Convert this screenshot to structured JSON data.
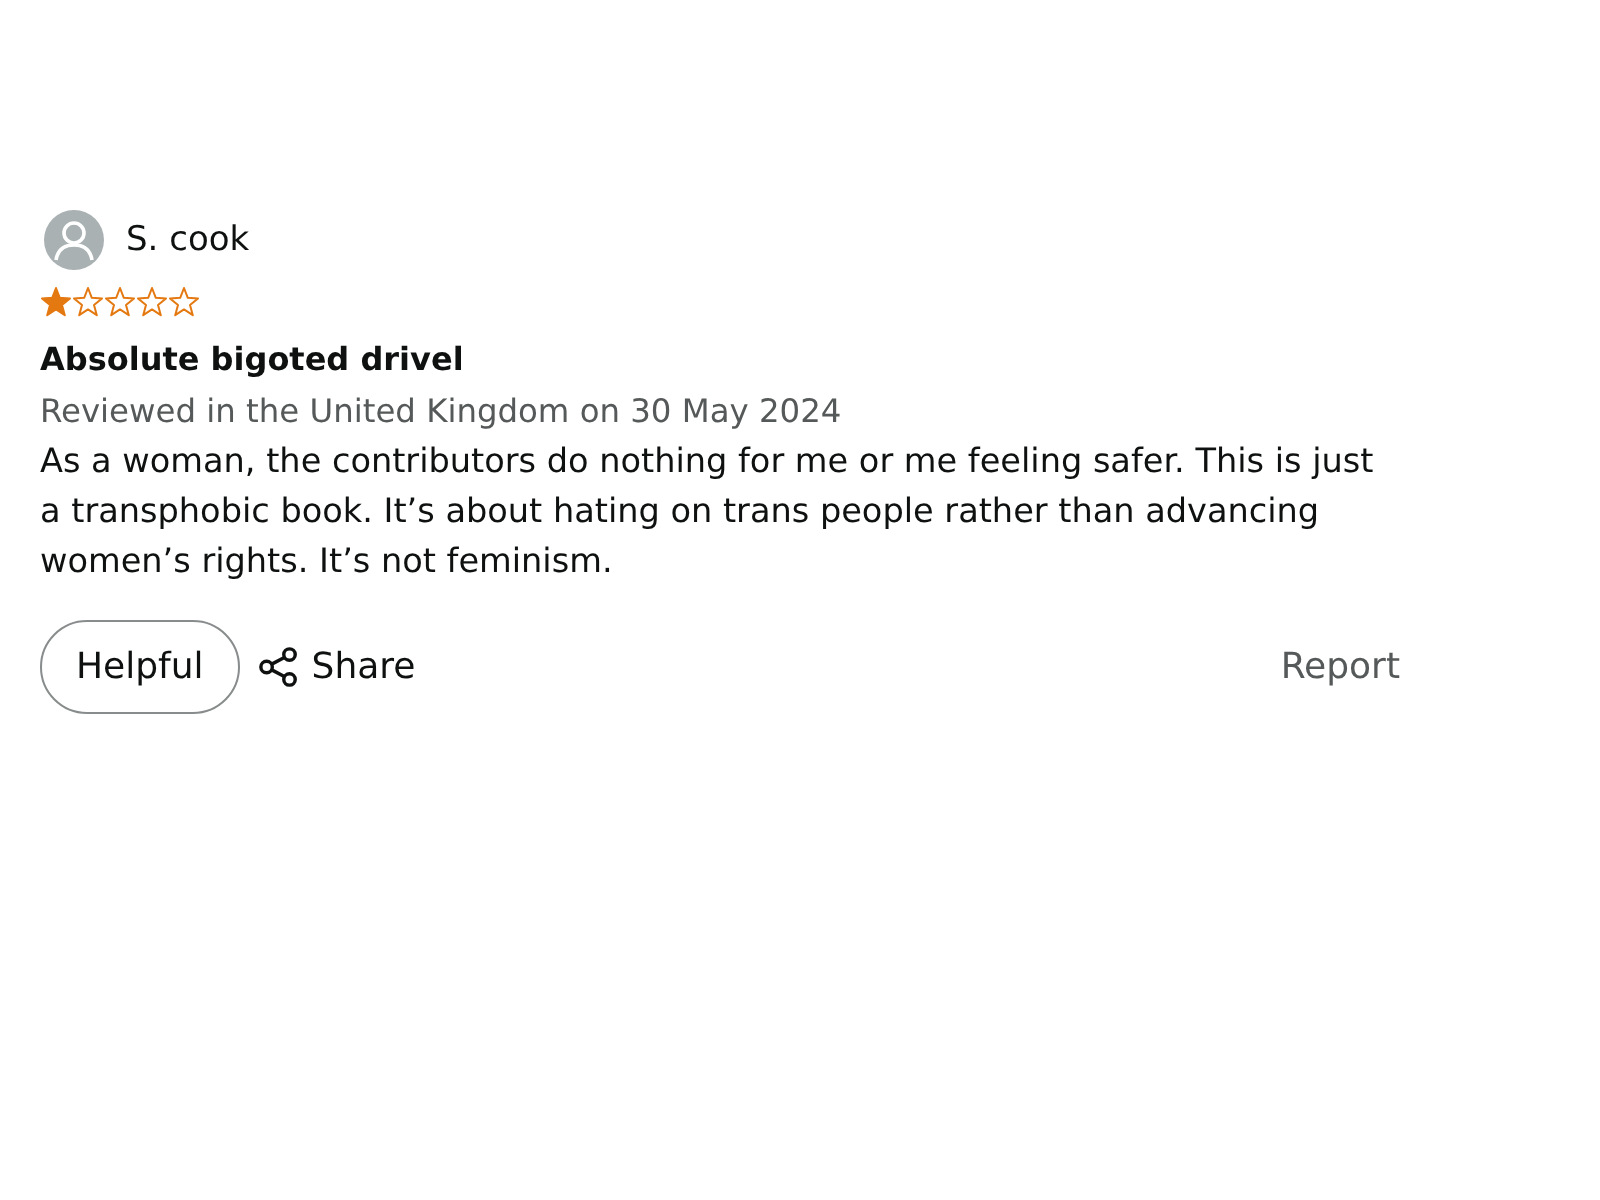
{
  "review": {
    "reviewer": "S. cook",
    "stars": 1,
    "title": "Absolute bigoted drivel",
    "meta": "Reviewed in the United Kingdom on 30 May 2024",
    "body": "As a woman, the contributors do nothing for me or me feeling safer. This is just a transphobic book. It’s about hating on trans people rather than advancing women’s rights. It’s not feminism.",
    "actions": {
      "helpful": "Helpful",
      "share": "Share",
      "report": "Report"
    }
  }
}
